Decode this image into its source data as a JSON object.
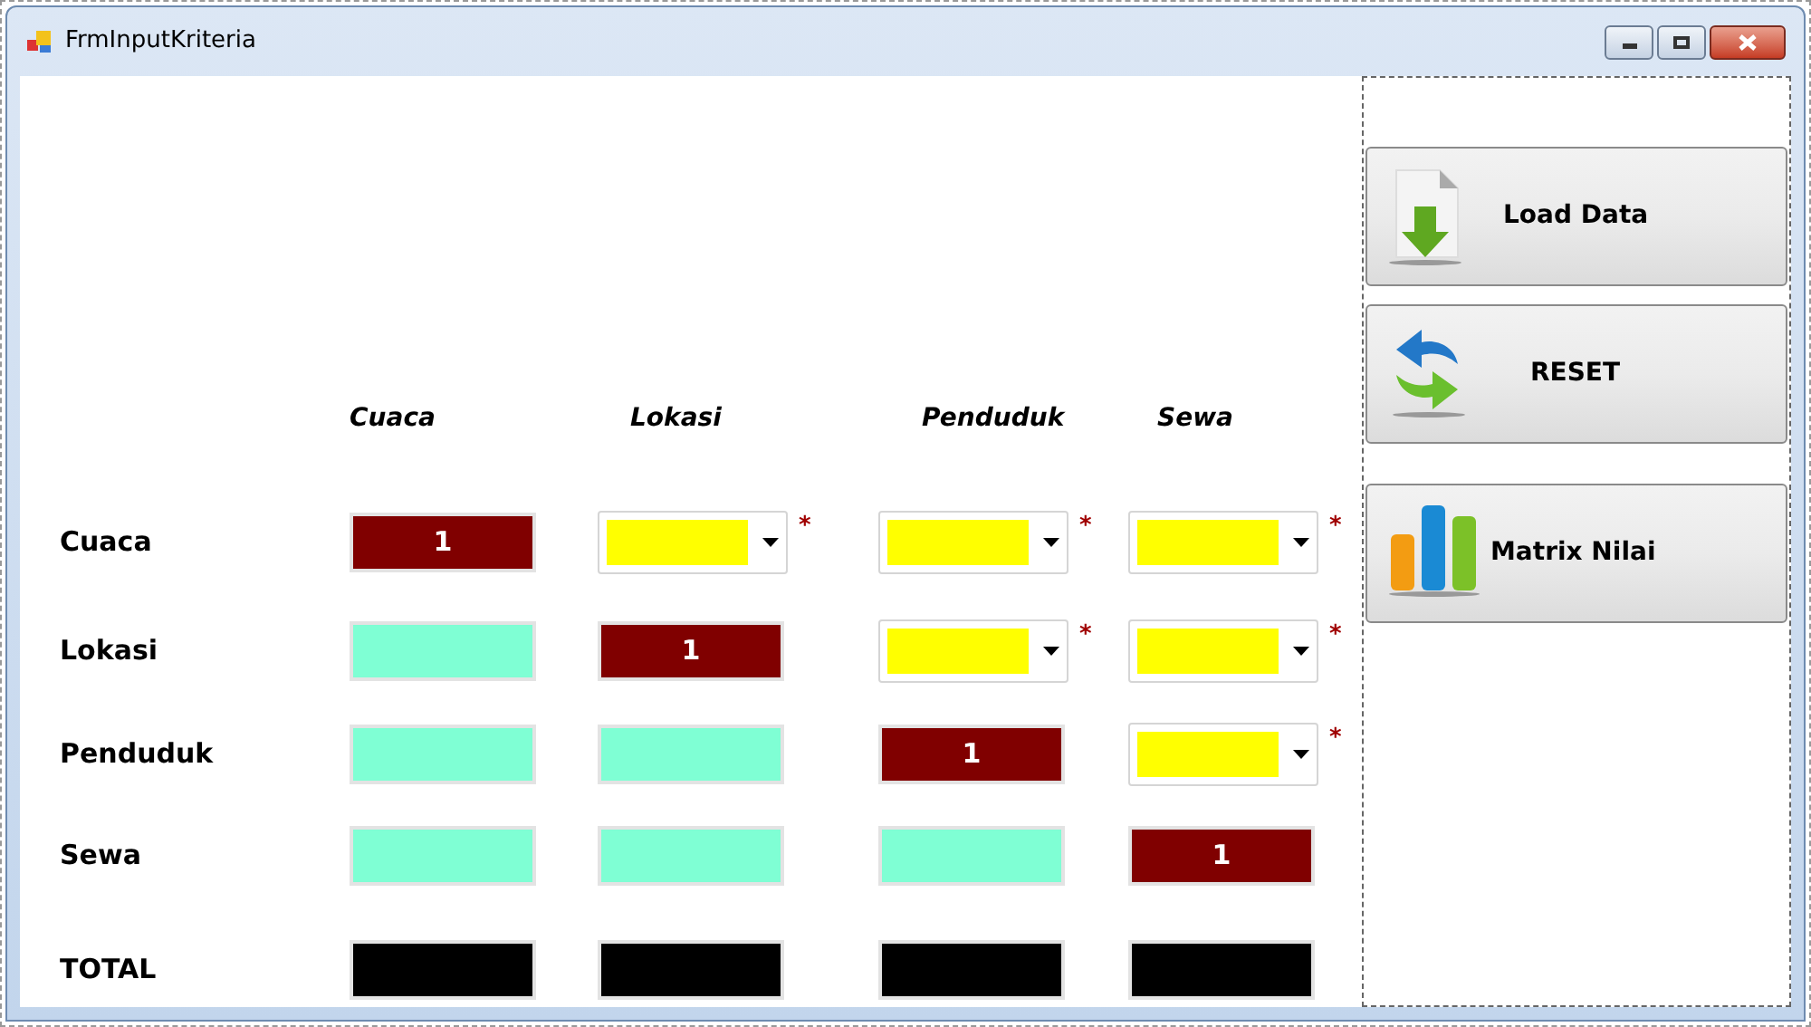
{
  "window": {
    "title": "FrmInputKriteria"
  },
  "columns": [
    "Cuaca",
    "Lokasi",
    "Penduduk",
    "Sewa"
  ],
  "rows": [
    {
      "label": "Cuaca",
      "cells": [
        {
          "kind": "diagonal",
          "value": "1"
        },
        {
          "kind": "dropdown",
          "required_mark": "*"
        },
        {
          "kind": "dropdown",
          "required_mark": "*"
        },
        {
          "kind": "dropdown",
          "required_mark": "*"
        }
      ]
    },
    {
      "label": "Lokasi",
      "cells": [
        {
          "kind": "computed"
        },
        {
          "kind": "diagonal",
          "value": "1"
        },
        {
          "kind": "dropdown",
          "required_mark": "*"
        },
        {
          "kind": "dropdown",
          "required_mark": "*"
        }
      ]
    },
    {
      "label": "Penduduk",
      "cells": [
        {
          "kind": "computed"
        },
        {
          "kind": "computed"
        },
        {
          "kind": "diagonal",
          "value": "1"
        },
        {
          "kind": "dropdown",
          "required_mark": "*"
        }
      ]
    },
    {
      "label": "Sewa",
      "cells": [
        {
          "kind": "computed"
        },
        {
          "kind": "computed"
        },
        {
          "kind": "computed"
        },
        {
          "kind": "diagonal",
          "value": "1"
        }
      ]
    }
  ],
  "total": {
    "label": "TOTAL",
    "cells": [
      {
        "kind": "total"
      },
      {
        "kind": "total"
      },
      {
        "kind": "total"
      },
      {
        "kind": "total"
      }
    ]
  },
  "buttons": [
    {
      "kind": "load",
      "label": "Load Data"
    },
    {
      "kind": "reset",
      "label": "RESET"
    },
    {
      "kind": "matrix",
      "label": "Matrix Nilai"
    }
  ]
}
